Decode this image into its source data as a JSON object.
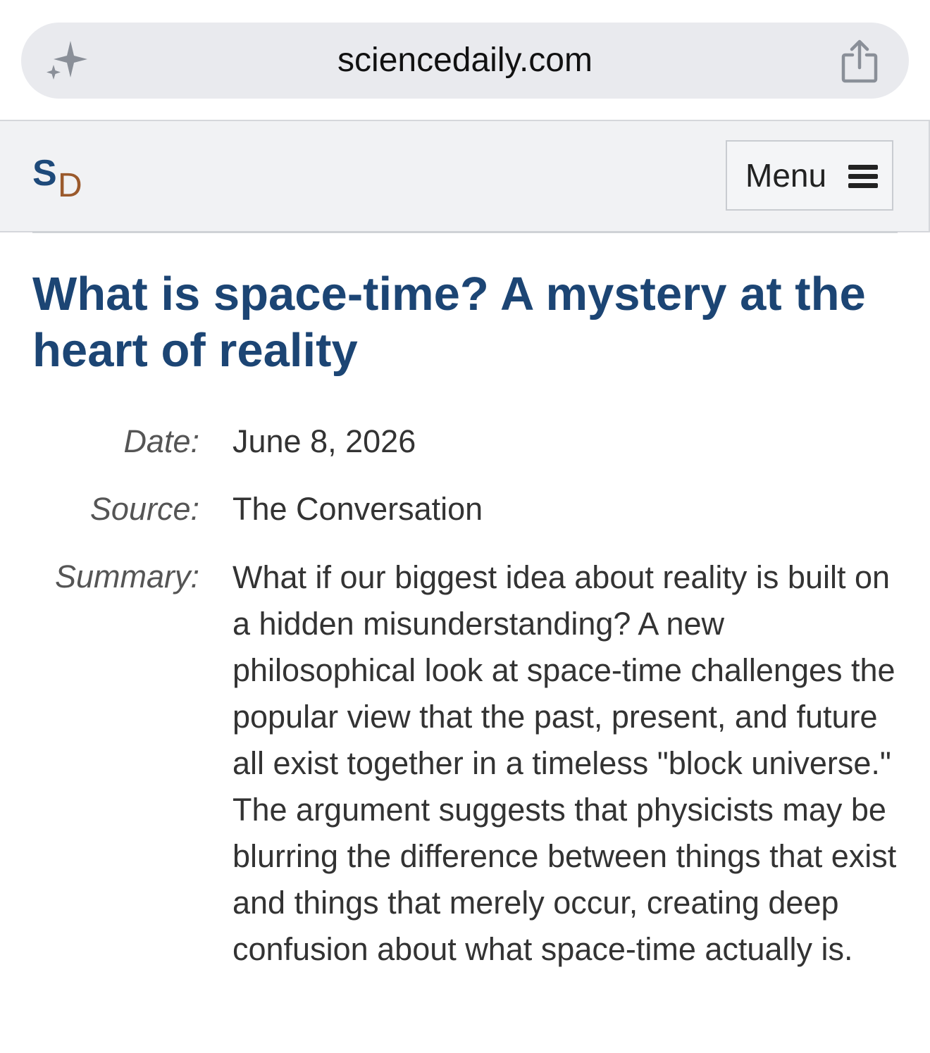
{
  "browser": {
    "url": "sciencedaily.com",
    "left_icon": "sparkle-icon",
    "right_icon": "share-icon"
  },
  "header": {
    "logo_s": "S",
    "logo_d": "D",
    "menu_label": "Menu",
    "menu_icon": "hamburger-icon",
    "colors": {
      "logo_s": "#1e4a7a",
      "logo_d": "#9b5a2c",
      "headline": "#1c4574"
    }
  },
  "article": {
    "title": "What is space-time? A mystery at the heart of reality",
    "date_label": "Date:",
    "date": "June 8, 2026",
    "source_label": "Source:",
    "source": "The Conversation",
    "summary_label": "Summary:",
    "summary": "What if our biggest idea about reality is built on a hidden misunderstanding? A new philosophical look at space-time challenges the popular view that the past, present, and future all exist together in a timeless \"block universe.\" The argument suggests that physicists may be blurring the difference between things that exist and things that merely occur, creating deep confusion about what space-time actually is."
  }
}
